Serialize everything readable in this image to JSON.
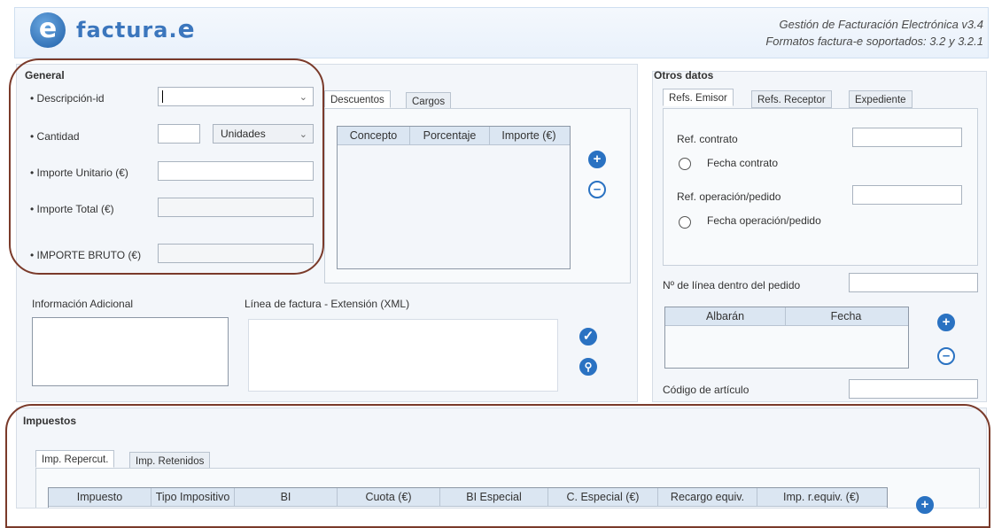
{
  "header": {
    "logo_letter": "e",
    "logo_name": "factura.",
    "logo_suffix": "e",
    "subtitle_line1": "Gestión de Facturación Electrónica v3.4",
    "subtitle_line2": "Formatos factura-e soportados: 3.2 y 3.2.1"
  },
  "general": {
    "title": "General",
    "descripcion_label": "• Descripción-id",
    "descripcion_value": "",
    "cantidad_label": "• Cantidad",
    "cantidad_value": "",
    "unidades_value": "Unidades",
    "importe_unitario_label": "• Importe Unitario (€)",
    "importe_total_label": "• Importe Total (€)",
    "importe_bruto_label": "• IMPORTE BRUTO (€)"
  },
  "descuentos": {
    "tab_descuentos": "Descuentos",
    "tab_cargos": "Cargos",
    "columns": [
      "Concepto",
      "Porcentaje",
      "Importe (€)"
    ]
  },
  "info": {
    "info_adicional_label": "Información Adicional",
    "extension_label": "Línea de factura - Extensión (XML)"
  },
  "otros": {
    "title": "Otros datos",
    "tabs": [
      "Refs. Emisor",
      "Refs. Receptor",
      "Expediente"
    ],
    "ref_contrato_label": "Ref. contrato",
    "fecha_contrato_label": "Fecha contrato",
    "ref_operacion_label": "Ref. operación/pedido",
    "fecha_operacion_label": "Fecha operación/pedido",
    "linea_pedido_label": "Nº de línea dentro del pedido",
    "albaran_columns": [
      "Albarán",
      "Fecha"
    ],
    "codigo_articulo_label": "Código de artículo"
  },
  "impuestos": {
    "title": "Impuestos",
    "tabs": [
      "Imp. Repercut.",
      "Imp. Retenidos"
    ],
    "columns": [
      "Impuesto",
      "Tipo Impositivo",
      "BI",
      "Cuota (€)",
      "BI Especial",
      "C. Especial (€)",
      "Recargo equiv.",
      "Imp. r.equiv. (€)"
    ]
  },
  "icons": {
    "add": "plus-circle-icon",
    "remove": "minus-circle-icon",
    "validate": "check-circle-icon",
    "view": "magnifier-icon"
  },
  "colors": {
    "accent": "#2a72c2",
    "annotation": "#7a3a2a"
  }
}
